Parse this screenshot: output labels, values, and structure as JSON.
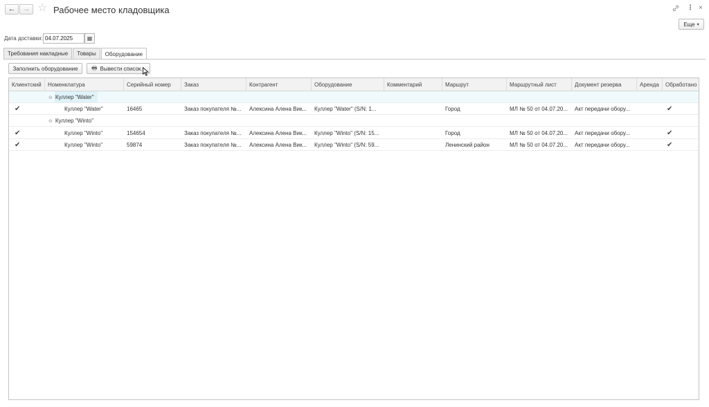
{
  "window": {
    "title": "Рабочее место кладовщика",
    "back_icon": "←",
    "fwd_icon": "→",
    "star_icon": "☆",
    "link_icon": "🔗",
    "menu_icon": "⋮",
    "close_icon": "×"
  },
  "more_button": {
    "label": "Еще",
    "caret": "▾"
  },
  "delivery_date": {
    "label": "Дата доставки:",
    "value": "04.07.2025",
    "calendar_icon": "▦"
  },
  "tabs": [
    {
      "label": "Требования накладные",
      "active": false
    },
    {
      "label": "Товары",
      "active": false
    },
    {
      "label": "Оборудование",
      "active": true
    }
  ],
  "toolbar": {
    "fill_label": "Заполнить оборудование",
    "print_label": "Вывести список...",
    "printer_icon": "🖶"
  },
  "table": {
    "columns": [
      "Клиентский",
      "Номенклатура",
      "Серийный номер",
      "Заказ",
      "Контрагент",
      "Оборудование",
      "Комментарий",
      "Маршрут",
      "Маршрутный лист",
      "Документ резерва",
      "Аренда",
      "Обработано"
    ],
    "groups": [
      {
        "title": "Куллер \"Water\"",
        "expand_icon": "⊖",
        "rows": [
          {
            "client": "✔",
            "nomenclature": "Куллер \"Water\"",
            "serial": "16465",
            "order": "Заказ покупателя №...",
            "counterparty": "Алексина Алена Вик...",
            "equipment": "Куллер \"Water\" (S/N: 1...",
            "comment": "",
            "route": "Город",
            "route_sheet": "МЛ № 50 от 04.07.20...",
            "reserve_doc": "Акт передачи обору...",
            "rent": "",
            "processed": "✔"
          }
        ]
      },
      {
        "title": "Куллер \"Winto\"",
        "expand_icon": "⊖",
        "rows": [
          {
            "client": "✔",
            "nomenclature": "Куллер \"Winto\"",
            "serial": "154654",
            "order": "Заказ покупателя №...",
            "counterparty": "Алексина Алена Вик...",
            "equipment": "Куллер \"Winto\" (S/N: 15...",
            "comment": "",
            "route": "Город",
            "route_sheet": "МЛ № 50 от 04.07.20...",
            "reserve_doc": "Акт передачи обору...",
            "rent": "",
            "processed": "✔"
          },
          {
            "client": "✔",
            "nomenclature": "Куллер \"Winto\"",
            "serial": "59874",
            "order": "Заказ покупателя №...",
            "counterparty": "Алексина Алена Вик...",
            "equipment": "Куллер \"Winto\" (S/N: 59...",
            "comment": "",
            "route": "Ленинский район",
            "route_sheet": "МЛ № 50 от 04.07.20...",
            "reserve_doc": "Акт передачи обору...",
            "rent": "",
            "processed": "✔"
          }
        ]
      }
    ]
  }
}
